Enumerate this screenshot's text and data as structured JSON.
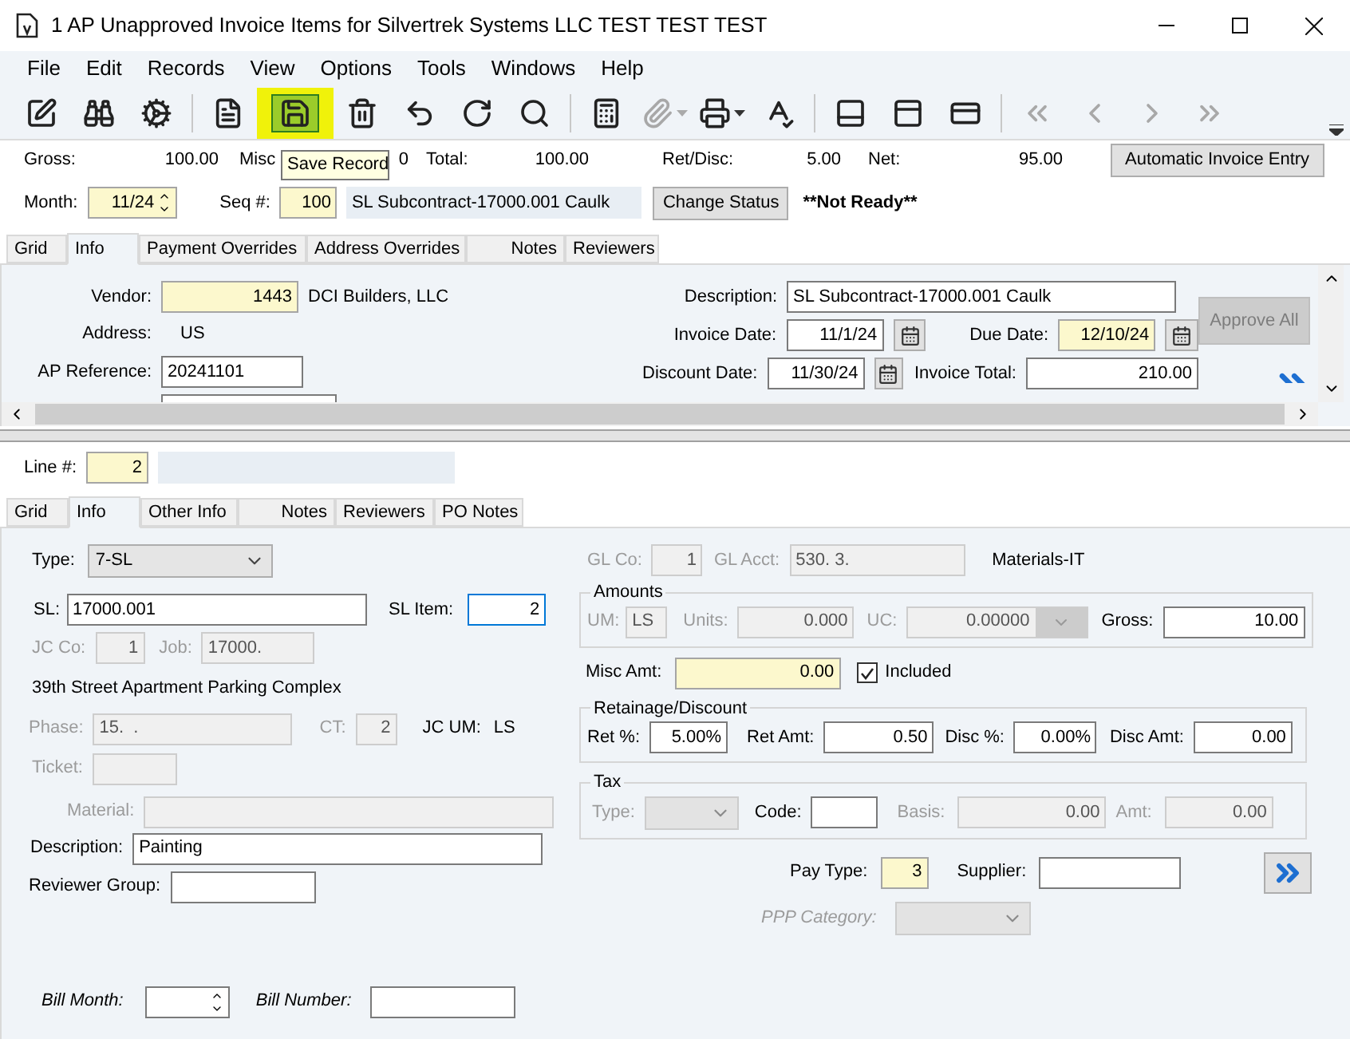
{
  "window": {
    "title": "1 AP Unapproved Invoice Items for Silvertrek Systems LLC TEST TEST TEST"
  },
  "menu": [
    "File",
    "Edit",
    "Records",
    "View",
    "Options",
    "Tools",
    "Windows",
    "Help"
  ],
  "toolbar": [
    {
      "disabled": false,
      "highlighted": false
    },
    {
      "disabled": false,
      "highlighted": false
    },
    {
      "disabled": false,
      "highlighted": false
    },
    {
      "disabled": false,
      "highlighted": false
    },
    {
      "disabled": false,
      "highlighted": true
    },
    {
      "disabled": false,
      "highlighted": false
    },
    {
      "disabled": false,
      "highlighted": false
    },
    {
      "disabled": false,
      "highlighted": false
    },
    {
      "disabled": false,
      "highlighted": false
    },
    {
      "disabled": false,
      "highlighted": false
    },
    {
      "disabled": true,
      "highlighted": false
    },
    {
      "disabled": false,
      "highlighted": false
    },
    {
      "disabled": false,
      "highlighted": false
    },
    {
      "disabled": false,
      "highlighted": false
    },
    {
      "disabled": false,
      "highlighted": false
    },
    {
      "disabled": false,
      "highlighted": false
    },
    {
      "disabled": true,
      "highlighted": false
    },
    {
      "disabled": true,
      "highlighted": false
    },
    {
      "disabled": true,
      "highlighted": false
    },
    {
      "disabled": true,
      "highlighted": false
    }
  ],
  "tooltip": "Save Record",
  "totals": [
    {
      "label": "Gross:",
      "value": "100.00"
    },
    {
      "label": "Misc",
      "value": "0"
    },
    {
      "label": "Total:",
      "value": "100.00"
    },
    {
      "label": "Ret/Disc:",
      "value": "5.00"
    },
    {
      "label": "Net:",
      "value": "95.00"
    }
  ],
  "auto_button": "Automatic Invoice Entry",
  "header": {
    "month": {
      "label": "Month:",
      "value": "11/24",
      "kind": "required"
    },
    "seq": {
      "label": "Seq #:",
      "value": "100",
      "kind": "required"
    },
    "description": "SL Subcontract-17000.001 Caulk",
    "change_status": "Change Status",
    "status": "**Not Ready**"
  },
  "header_tabs": [
    {
      "label": "Grid",
      "selected": false
    },
    {
      "label": "Info",
      "selected": true
    },
    {
      "label": "Payment Overrides",
      "selected": false
    },
    {
      "label": "Address Overrides",
      "selected": false
    },
    {
      "label": "Notes",
      "selected": false
    },
    {
      "label": "Reviewers",
      "selected": false
    }
  ],
  "header_panel": {
    "vendor": {
      "label": "Vendor:",
      "value": "1443",
      "kind": "required",
      "name": "DCI Builders, LLC"
    },
    "address": {
      "label": "Address:",
      "value": "US"
    },
    "ap_reference": {
      "label": "AP Reference:",
      "value": "20241101",
      "kind": "entry"
    },
    "description": {
      "label": "Description:",
      "value": "SL Subcontract-17000.001 Caulk",
      "kind": "entry"
    },
    "invoice_date": {
      "label": "Invoice Date:",
      "value": "11/1/24",
      "kind": "entry"
    },
    "due_date": {
      "label": "Due Date:",
      "value": "12/10/24",
      "kind": "required"
    },
    "discount_date": {
      "label": "Discount Date:",
      "value": "11/30/24",
      "kind": "entry"
    },
    "invoice_total": {
      "label": "Invoice Total:",
      "value": "210.00",
      "kind": "entry"
    },
    "approve_all": {
      "label": "Approve All",
      "disabled": true
    }
  },
  "line": {
    "label": "Line #:",
    "value": "2",
    "kind": "required"
  },
  "line_tabs": [
    {
      "label": "Grid",
      "selected": false
    },
    {
      "label": "Info",
      "selected": true
    },
    {
      "label": "Other Info",
      "selected": false
    },
    {
      "label": "Notes",
      "selected": false
    },
    {
      "label": "Reviewers",
      "selected": false
    },
    {
      "label": "PO Notes",
      "selected": false
    }
  ],
  "line_panel": {
    "type": {
      "label": "Type:",
      "value": "7-SL",
      "disabled": false
    },
    "sl": {
      "label": "SL:",
      "value": "17000.001",
      "kind": "entry"
    },
    "sl_item": {
      "label": "SL Item:",
      "value": "2",
      "kind": "entry",
      "focused": true
    },
    "jc_co": {
      "label": "JC Co:",
      "value": "1",
      "kind": "disabled"
    },
    "job": {
      "label": "Job:",
      "value": "17000.",
      "kind": "disabled"
    },
    "job_name": "39th Street Apartment Parking Complex",
    "phase": {
      "label": "Phase:",
      "value": "15.  .",
      "kind": "disabled"
    },
    "ct": {
      "label": "CT:",
      "value": "2",
      "kind": "disabled"
    },
    "jc_um": {
      "label": "JC UM:",
      "value": "LS"
    },
    "ticket": {
      "label": "Ticket:",
      "kind": "disabled"
    },
    "material": {
      "label": "Material:",
      "kind": "disabled"
    },
    "description": {
      "label": "Description:",
      "value": "Painting",
      "kind": "entry"
    },
    "reviewer_group": {
      "label": "Reviewer Group:",
      "kind": "entry"
    },
    "bill_month": {
      "label": "Bill Month:",
      "kind": "entry"
    },
    "bill_number": {
      "label": "Bill Number:",
      "kind": "entry"
    },
    "gl_co": {
      "label": "GL Co:",
      "value": "1",
      "kind": "disabled"
    },
    "gl_acct": {
      "label": "GL Acct:",
      "value": "530. 3.",
      "kind": "disabled"
    },
    "gl_desc": "Materials-IT",
    "amounts": {
      "title": "Amounts",
      "um": {
        "label": "UM:",
        "value": "LS",
        "kind": "disabled"
      },
      "units": {
        "label": "Units:",
        "value": "0.000",
        "kind": "disabled"
      },
      "uc": {
        "label": "UC:",
        "value": "0.00000",
        "kind": "disabled"
      },
      "gross": {
        "label": "Gross:",
        "value": "10.00",
        "kind": "entry"
      }
    },
    "misc_amt": {
      "label": "Misc Amt:",
      "value": "0.00",
      "kind": "required"
    },
    "included": {
      "label": "Included",
      "checked": true
    },
    "retainage": {
      "title": "Retainage/Discount",
      "ret_pct": {
        "label": "Ret %:",
        "value": "5.00%",
        "kind": "entry"
      },
      "ret_amt": {
        "label": "Ret Amt:",
        "value": "0.50",
        "kind": "entry"
      },
      "disc_pct": {
        "label": "Disc %:",
        "value": "0.00%",
        "kind": "entry"
      },
      "disc_amt": {
        "label": "Disc Amt:",
        "value": "0.00",
        "kind": "entry"
      }
    },
    "tax": {
      "title": "Tax",
      "type": {
        "label": "Type:",
        "disabled": true
      },
      "code": {
        "label": "Code:",
        "kind": "entry"
      },
      "basis": {
        "label": "Basis:",
        "value": "0.00",
        "kind": "disabled"
      },
      "amt": {
        "label": "Amt:",
        "value": "0.00",
        "kind": "disabled"
      }
    },
    "pay_type": {
      "label": "Pay Type:",
      "value": "3",
      "kind": "required"
    },
    "supplier": {
      "label": "Supplier:",
      "kind": "entry"
    },
    "ppp_category": {
      "label": "PPP Category:",
      "disabled": true
    }
  }
}
